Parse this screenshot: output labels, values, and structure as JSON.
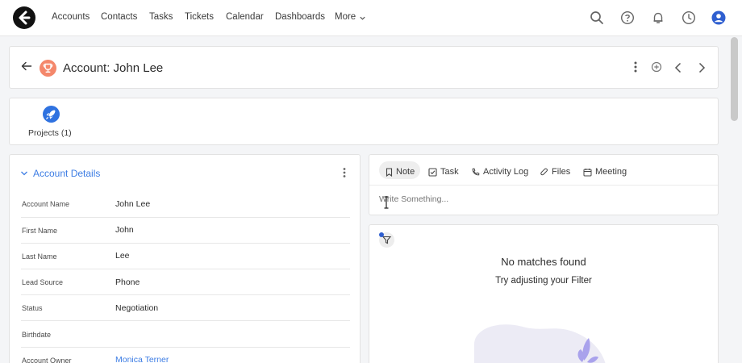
{
  "nav": {
    "items": [
      "Accounts",
      "Contacts",
      "Tasks",
      "Tickets",
      "Calendar",
      "Dashboards"
    ],
    "more_label": "More",
    "icons": [
      "search-icon",
      "help-icon",
      "bell-icon",
      "clock-icon",
      "user-icon"
    ]
  },
  "header": {
    "title": "Account: John Lee",
    "accent": "#f4876b"
  },
  "related": {
    "projects_label": "Projects (1)"
  },
  "details": {
    "section_title": "Account Details",
    "rows": [
      {
        "label": "Account Name",
        "value": "John Lee"
      },
      {
        "label": "First Name",
        "value": "John"
      },
      {
        "label": "Last Name",
        "value": "Lee"
      },
      {
        "label": "Lead Source",
        "value": "Phone"
      },
      {
        "label": "Status",
        "value": "Negotiation"
      },
      {
        "label": "Birthdate",
        "value": ""
      },
      {
        "label": "Account Owner",
        "value": "Monica Terner"
      }
    ]
  },
  "activity": {
    "tabs": [
      "Note",
      "Task",
      "Activity Log",
      "Files",
      "Meeting"
    ],
    "placeholder": "Write Something..."
  },
  "feed": {
    "empty_title": "No matches found",
    "empty_sub": "Try adjusting your Filter"
  },
  "colors": {
    "link": "#3d7de4",
    "brand_dark": "#111111",
    "avatar_blue": "#2f5fd0"
  }
}
